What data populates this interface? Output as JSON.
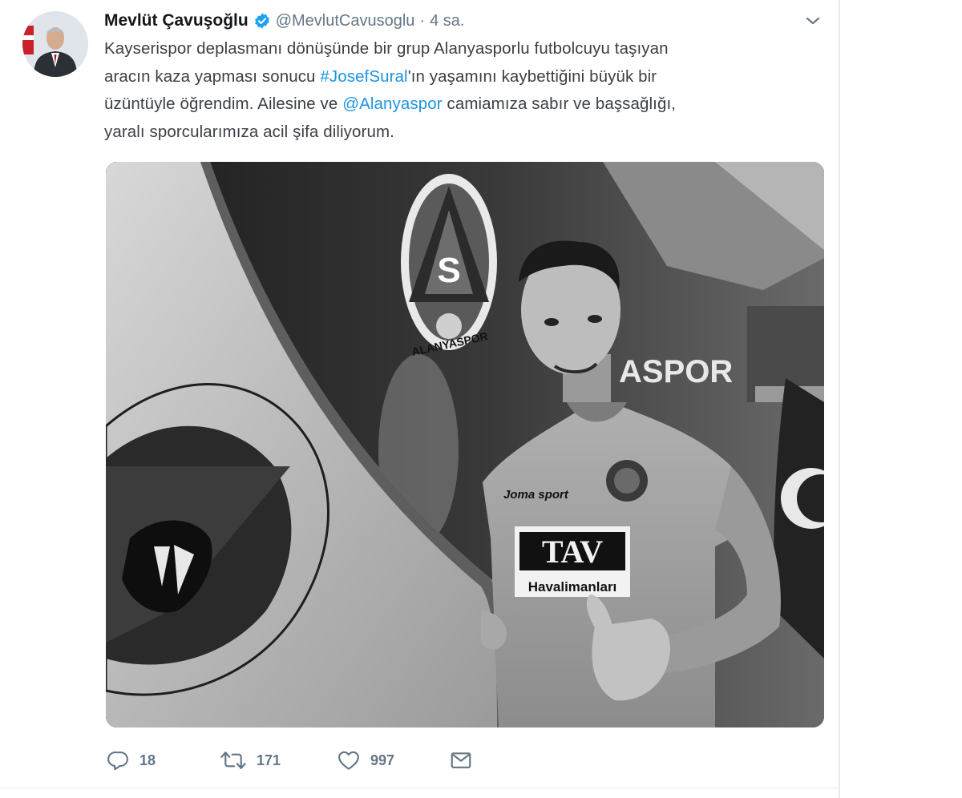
{
  "tweet": {
    "author": {
      "display_name": "Mevlüt Çavuşoğlu",
      "screen_name": "@MevlutCavusoglu",
      "verified": true,
      "avatar_icon": "profile-photo"
    },
    "timestamp": "4 sa.",
    "separator": "·",
    "text_lines": [
      [
        "Kayserispor deplasmanı dönüşünde bir grup Alanyasporlu futbolcuyu taşıyan"
      ],
      [
        "aracın kaza yapması sonucu  ",
        "#JosefSural",
        "'ın yaşamını kaybettiğini büyük bir"
      ],
      [
        "üzüntüyle öğrendim. Ailesine ve ",
        "@Alanyaspor",
        " camiamıza sabır ve başsağlığı,"
      ],
      [
        "yaralı sporcularımıza acil şifa diliyorum."
      ]
    ],
    "hashtag": "#JosefSural",
    "mention": "@Alanyaspor",
    "media": {
      "kind": "photo",
      "logo_text": "ALANYASPOR",
      "wall_text": "ASPOR",
      "jersey_sponsor_top": "TAV",
      "jersey_sponsor_bottom": "Havalimanları",
      "jersey_brand": "Joma sport"
    },
    "actions": {
      "replies": "18",
      "retweets": "171",
      "likes": "997"
    },
    "colors": {
      "link": "#1b95e0",
      "verified": "#1da1f2",
      "meta": "#657786"
    }
  }
}
